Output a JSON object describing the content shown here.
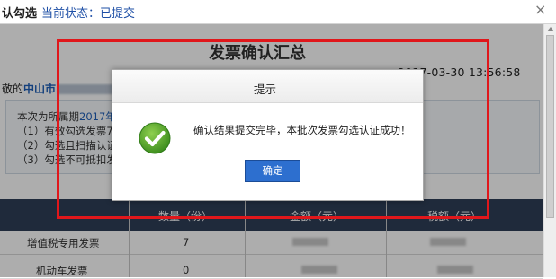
{
  "window": {
    "title": "认勾选",
    "status": "当前状态：已提交",
    "close_glyph": "×"
  },
  "page": {
    "heading": "发票确认汇总",
    "datetime_fragment": "2017-03-30 13:56:58",
    "greeting_prefix": "敬的",
    "greeting_city": "中山市",
    "info": {
      "line1_prefix": "本次为所属期",
      "line1_period": "2017年",
      "line2": "（1）有效勾选发票7",
      "line3": "（2）勾选且扫描认证",
      "line4": "（3）勾选不可抵扣发"
    }
  },
  "table": {
    "headers": [
      "数量（份）",
      "金额（元）",
      "税额（元）"
    ],
    "rows": [
      {
        "label": "增值税专用发票",
        "count": "7"
      },
      {
        "label": "机动车发票",
        "count": "0"
      }
    ]
  },
  "dialog": {
    "title": "提示",
    "message": "确认结果提交完毕，本批次发票勾选认证成功！",
    "ok_label": "确定",
    "icon": "check-circle-icon"
  },
  "colors": {
    "accent": "#2d6fcf",
    "highlight_frame": "#e0171b",
    "table_header": "#2f3e58",
    "success": "#5aa72b"
  }
}
